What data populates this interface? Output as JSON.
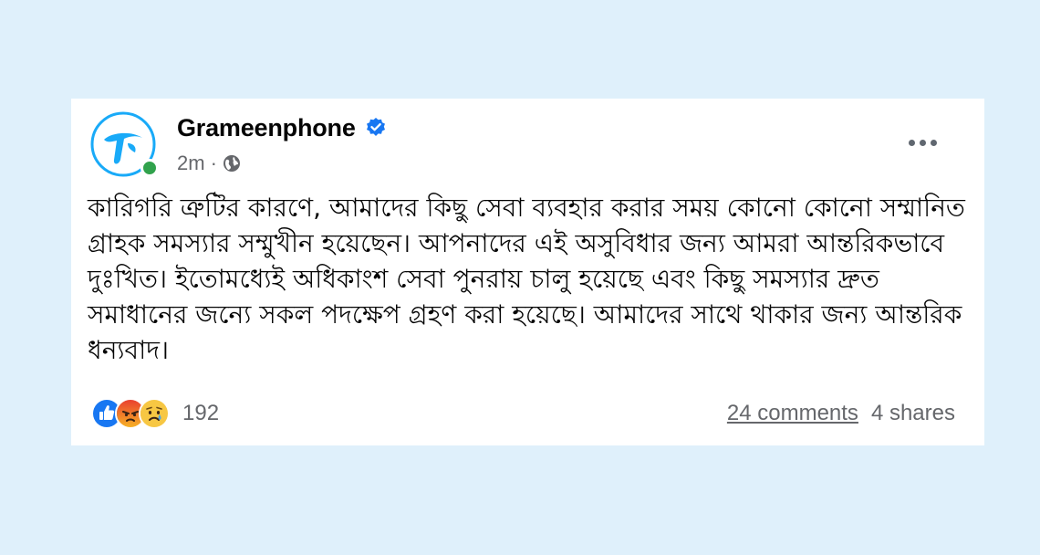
{
  "post": {
    "page_name": "Grameenphone",
    "time": "2m",
    "separator": "·",
    "body": "কারিগরি ত্রুটির কারণে, আমাদের কিছু সেবা ব্যবহার করার সময় কোনো কোনো সম্মানিত গ্রাহক সমস্যার সম্মুখীন হয়েছেন। আপনাদের এই অসুবিধার জন্য আমরা আন্তরিকভাবে দুঃখিত। ইতোমধ্যেই অধিকাংশ সেবা পুনরায় চালু হয়েছে এবং কিছু সমস্যার দ্রুত সমাধানের জন্যে সকল পদক্ষেপ গ্রহণ করা হয়েছে। আমাদের সাথে থাকার জন্য আন্তরিক ধন্যবাদ।",
    "reaction_count": "192",
    "comments": "24 comments",
    "shares": "4 shares",
    "reactions": [
      "like",
      "angry",
      "sad"
    ]
  },
  "icons": {
    "avatar": "grameenphone-logo",
    "verified": "verified-badge-icon",
    "audience": "globe-icon",
    "more": "more-options-icon"
  },
  "colors": {
    "background": "#dff0fb",
    "verified": "#1877f2",
    "online": "#31a24c",
    "logo": "#19aaf8"
  }
}
